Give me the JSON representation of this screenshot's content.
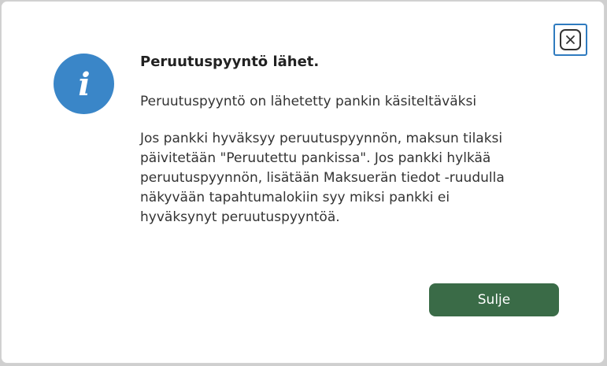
{
  "dialog": {
    "title": "Peruutuspyyntö lähet.",
    "subtitle": "Peruutuspyyntö on lähetetty pankin käsiteltäväksi",
    "body": "Jos pankki hyväksyy peruutuspyynnön, maksun tilaksi päivitetään \"Peruutettu pankissa\". Jos pankki hylkää peruutuspyynnön, lisätään Maksuerän tiedot -ruudulla näkyvään tapahtumalokiin syy miksi pankki ei hyväksynyt peruutuspyyntöä.",
    "close_button_label": "Sulje",
    "icon": "info-icon",
    "close_icon": "close-icon"
  },
  "colors": {
    "info_icon_bg": "#3a86c8",
    "button_bg": "#3a6b47",
    "focus_ring": "#2f7bbf"
  }
}
